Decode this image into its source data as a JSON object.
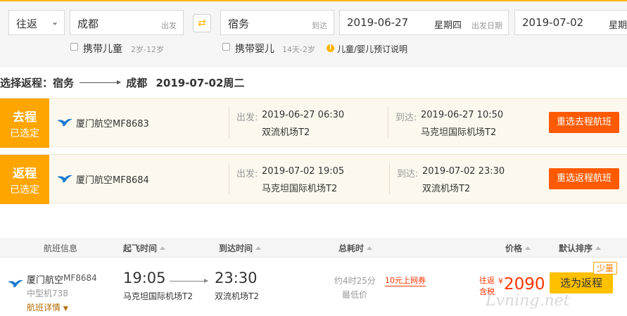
{
  "search": {
    "trip_type": "往返",
    "from_city": "成都",
    "from_suffix": "出发",
    "to_city": "宿务",
    "to_suffix": "到达",
    "depart_date": "2019-06-27",
    "depart_weekday": "星期四",
    "depart_suffix": "出发日期",
    "return_date": "2019-07-02",
    "return_weekday": "星期",
    "child_label": "携带儿童",
    "child_age": "2岁-12岁",
    "infant_label": "携带婴儿",
    "infant_age": "14天-2岁",
    "info_link": "儿童/婴儿预订说明"
  },
  "selection": {
    "prefix": "选择返程：宿务",
    "to": "成都",
    "date": "2019-07-02周二"
  },
  "legs": [
    {
      "tag_top": "去程",
      "tag_bottom": "已选定",
      "flight": "厦门航空MF8683",
      "dep_label": "出发:",
      "dep_time": "2019-06-27 06:30",
      "dep_airport": "双流机场T2",
      "arr_label": "到达:",
      "arr_time": "2019-06-27 10:50",
      "arr_airport": "马克坦国际机场T2",
      "button": "重选去程航班"
    },
    {
      "tag_top": "返程",
      "tag_bottom": "已选定",
      "flight": "厦门航空MF8684",
      "dep_label": "出发:",
      "dep_time": "2019-07-02 19:05",
      "dep_airport": "马克坦国际机场T2",
      "arr_label": "到达:",
      "arr_time": "2019-07-02 23:30",
      "arr_airport": "双流机场T2",
      "button": "重选返程航班"
    }
  ],
  "table_header": {
    "flight_info": "航班信息",
    "depart_time": "起飞时间",
    "arrive_time": "到达时间",
    "duration": "总耗时",
    "price": "价格",
    "sort": "默认排序"
  },
  "result": {
    "airline": "厦门航空",
    "flight_no": "MF8684",
    "aircraft": "中型机738",
    "details_link": "航班详情",
    "dep_time": "19:05",
    "dep_airport": "马克坦国际机场T2",
    "arr_time": "23:30",
    "arr_airport": "双流机场T2",
    "duration": "约4时25分",
    "lowest": "最低价",
    "coupon": "10元上网券",
    "price_label_1": "往返",
    "price_label_2": "含税",
    "price": "2090",
    "select_button": "选为返程",
    "badge": "少量"
  },
  "watermark": "Lvning.net",
  "colors": {
    "accent": "#ffb400",
    "tag_orange": "#ffa500",
    "button_orange": "#ff5a00",
    "price_red": "#ff3300",
    "select_yellow": "#ffc000",
    "airline_blue": "#1a7bd1"
  }
}
